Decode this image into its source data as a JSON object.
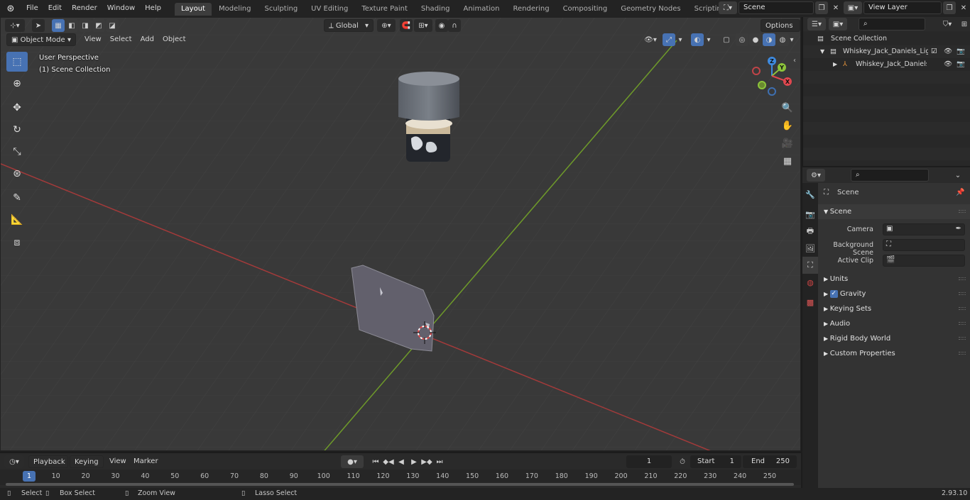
{
  "menu": {
    "items": [
      "File",
      "Edit",
      "Render",
      "Window",
      "Help"
    ]
  },
  "workspaces": {
    "tabs": [
      "Layout",
      "Modeling",
      "Sculpting",
      "UV Editing",
      "Texture Paint",
      "Shading",
      "Animation",
      "Rendering",
      "Compositing",
      "Geometry Nodes",
      "Scripting"
    ],
    "add_label": "+"
  },
  "scene_selector": {
    "value": "Scene"
  },
  "view_layer_selector": {
    "value": "View Layer"
  },
  "viewport": {
    "mode": "Object Mode",
    "menus": [
      "View",
      "Select",
      "Add",
      "Object"
    ],
    "transform_orientation": "Global",
    "options_label": "Options",
    "overlay_title": "User Perspective",
    "overlay_collection": "(1) Scene Collection"
  },
  "gizmo": {
    "z": "Z",
    "y": "Y",
    "x": "X"
  },
  "outliner": {
    "rows": [
      {
        "label": "Scene Collection"
      },
      {
        "label": "Whiskey_Jack_Daniels_Light_S"
      },
      {
        "label": "Whiskey_Jack_Daniels_Li"
      }
    ]
  },
  "properties": {
    "header_title": "Scene",
    "section_scene": "Scene",
    "fields": [
      {
        "label": "Camera"
      },
      {
        "label": "Background Scene"
      },
      {
        "label": "Active Clip"
      }
    ],
    "panels": [
      {
        "label": "Units",
        "checkbox": false
      },
      {
        "label": "Gravity",
        "checkbox": true
      },
      {
        "label": "Keying Sets",
        "checkbox": false
      },
      {
        "label": "Audio",
        "checkbox": false
      },
      {
        "label": "Rigid Body World",
        "checkbox": false
      },
      {
        "label": "Custom Properties",
        "checkbox": false
      }
    ]
  },
  "timeline": {
    "menus": [
      "Playback",
      "Keying",
      "View",
      "Marker"
    ],
    "current_frame": "1",
    "start_label": "Start",
    "start_value": "1",
    "end_label": "End",
    "end_value": "250",
    "ruler": [
      "1",
      "10",
      "20",
      "30",
      "40",
      "50",
      "60",
      "70",
      "80",
      "90",
      "100",
      "110",
      "120",
      "130",
      "140",
      "150",
      "160",
      "170",
      "180",
      "190",
      "200",
      "210",
      "220",
      "230",
      "240",
      "250"
    ]
  },
  "statusbar": {
    "select": "Select",
    "box_select": "Box Select",
    "zoom_view": "Zoom View",
    "lasso_select": "Lasso Select",
    "version": "2.93.10"
  },
  "colors": {
    "accent": "#4772b3",
    "x_axis": "#a33a3a",
    "y_axis": "#6e9a2a",
    "gizmo_x": "#e0474f",
    "gizmo_y": "#8cc43b",
    "gizmo_z": "#3e8be0"
  }
}
